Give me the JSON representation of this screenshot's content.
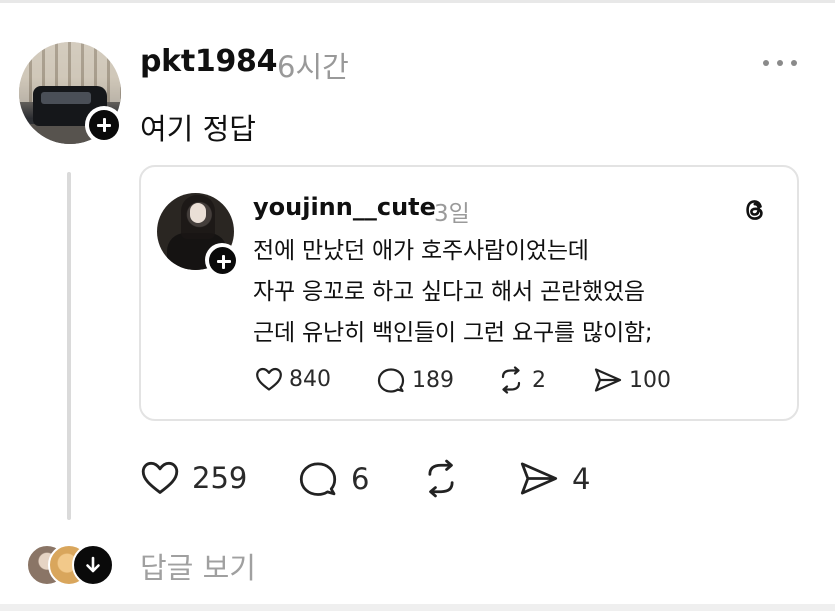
{
  "post": {
    "username": "pkt1984",
    "time": "6시간",
    "text": "여기 정답",
    "stats": {
      "likes": "259",
      "comments": "6",
      "shares": "4"
    }
  },
  "quote": {
    "username": "youjinn__cute",
    "time": "3일",
    "lines": [
      "전에 만났던 애가 호주사람이었는데",
      "자꾸 응꼬로 하고 싶다고 해서 곤란했었음",
      "근데 유난히 백인들이 그런 요구를 많이함;"
    ],
    "stats": {
      "likes": "840",
      "comments": "189",
      "reposts": "2",
      "shares": "100"
    }
  },
  "footer": {
    "view_replies": "답글 보기"
  },
  "icons": {
    "more": "more-horizontal-icon",
    "follow": "plus-icon",
    "threads": "threads-logo-icon",
    "like": "heart-icon",
    "comment": "comment-bubble-icon",
    "repost": "repost-icon",
    "share": "send-icon",
    "expand": "arrow-down-icon"
  },
  "colors": {
    "text": "#101010",
    "muted": "#999999",
    "divider": "#e3e3e3"
  }
}
